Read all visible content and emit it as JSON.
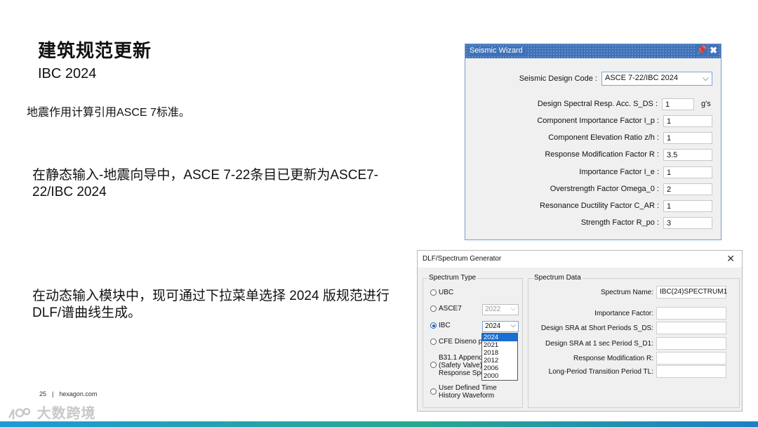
{
  "slide": {
    "title": "建筑规范更新",
    "subtitle": "IBC 2024",
    "para1": "地震作用计算引用ASCE 7标准。",
    "para2": "在静态输入-地震向导中，ASCE 7-22条目已更新为ASCE7-22/IBC 2024",
    "para3": "在动态输入模块中，现可通过下拉菜单选择 2024 版规范进行 DLF/谱曲线生成。",
    "footer_page": "25",
    "footer_sep": "|",
    "footer_site": "hexagon.com",
    "watermark": "大数跨境"
  },
  "seismic_wizard": {
    "title": "Seismic Wizard",
    "pin_icon": "📌",
    "close_icon": "✖",
    "design_code_label": "Seismic Design Code :",
    "design_code_value": "ASCE 7-22/IBC 2024",
    "fields": [
      {
        "label": "Design Spectral Resp. Acc. S_DS :",
        "value": "1",
        "unit": "g's"
      },
      {
        "label": "Component Importance Factor I_p :",
        "value": "1"
      },
      {
        "label": "Component Elevation Ratio z/h :",
        "value": "1"
      },
      {
        "label": "Response Modification Factor R :",
        "value": "3.5"
      },
      {
        "label": "Importance Factor I_e :",
        "value": "1"
      },
      {
        "label": "Overstrength Factor Omega_0 :",
        "value": "2"
      },
      {
        "label": "Resonance Ductility Factor C_AR :",
        "value": "1"
      },
      {
        "label": "Strength Factor R_po :",
        "value": "3"
      }
    ]
  },
  "dlf": {
    "title": "DLF/Spectrum Generator",
    "close": "✕",
    "spectrum_type_label": "Spectrum Type",
    "spectrum_data_label": "Spectrum Data",
    "types": {
      "ubc": "UBC",
      "asce7": "ASCE7",
      "asce7_year": "2022",
      "ibc": "IBC",
      "ibc_year": "2024",
      "cfe": "CFE Diseno po",
      "b311_line1": "B31.1 Appendiz",
      "b311_line2": "(Safety Valve) R",
      "b311_line3": "Response Spec",
      "user_line1": "User Defined Time",
      "user_line2": "History Waveform"
    },
    "year_options": [
      "2024",
      "2021",
      "2018",
      "2012",
      "2006",
      "2000"
    ],
    "data_fields": [
      {
        "label": "Spectrum Name:",
        "value": "IBC(24)SPECTRUM1"
      },
      {
        "label": "Importance Factor:",
        "value": ""
      },
      {
        "label": "Design SRA at Short Periods S_DS:",
        "value": ""
      },
      {
        "label": "Design SRA at 1 sec Period  S_D1:",
        "value": ""
      },
      {
        "label": "Response Modification R:",
        "value": ""
      },
      {
        "label": "Long-Period Transition Period TL:",
        "value": ""
      }
    ]
  }
}
